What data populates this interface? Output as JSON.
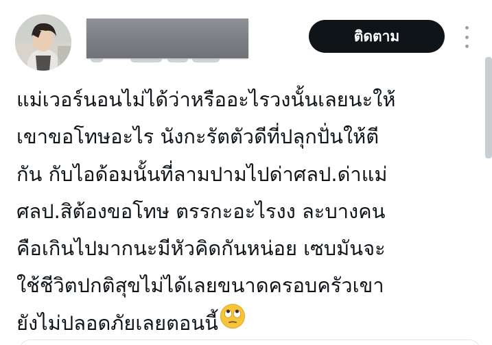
{
  "post": {
    "follow_label": "ติดตาม",
    "text_lines": [
      "แม่เวอร์นอนไม่ได้ว่าหรืออะไรวงนั้นเลยนะให้",
      "เขาขอโทษอะไร นังกะรัตตัวดีที่ปลุกปั่นให้ตี",
      "กัน กับไอด้อมนั้นที่ลามปามไปด่าศลป.ด่าแม่",
      "ศลป.สิต้องขอโทษ ตรรกะอะไรงง ละบางคน",
      "คือเกินไปมากนะมีหัวคิดกันหน่อย เซบมันจะ",
      "ใช้ชีวิตปกติสุขไม่ได้เลยขนาดครอบครัวเขา",
      "ยังไม่ปลอดภัยเลยตอนนี้"
    ],
    "trailing_emoji": "face-with-rolling-eyes-emoji"
  },
  "colors": {
    "text": "#0f1419",
    "button_bg": "#0f1419",
    "button_text": "#ffffff",
    "redaction": "#7c8086",
    "menu_dots": "#9aa3ab"
  },
  "icons": {
    "more_menu": "vertical-ellipsis-icon"
  }
}
